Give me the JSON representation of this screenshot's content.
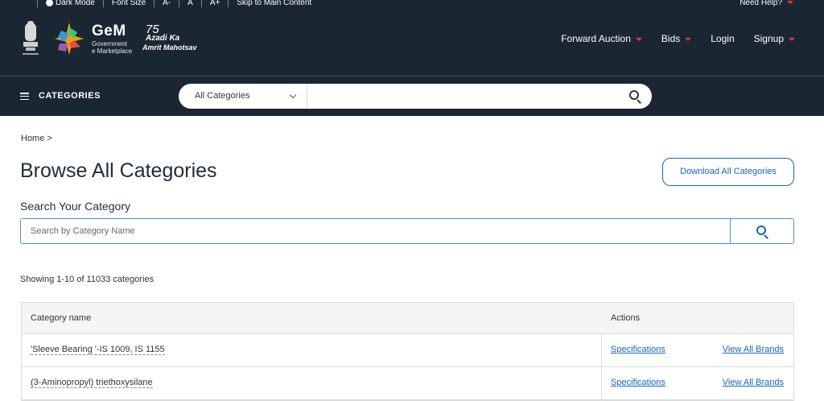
{
  "utility_bar": {
    "dark_mode_label": "Dark Mode",
    "font_size_label": "Font Size",
    "font_decrease": "A-",
    "font_normal": "A",
    "font_increase": "A+",
    "skip_link": "Skip to Main Content",
    "help_label": "Need Help?"
  },
  "header": {
    "logo_title": "GeM",
    "logo_line1": "Government",
    "logo_line2": "e Marketplace",
    "azadi_line1": "75",
    "azadi_line2": "Azadi Ka",
    "azadi_line3": "Amrit Mahotsav",
    "nav": {
      "forward_auction": "Forward Auction",
      "bids": "Bids",
      "login": "Login",
      "signup": "Signup"
    }
  },
  "category_bar": {
    "label": "CATEGORIES",
    "select_value": "All Categories",
    "search_value": ""
  },
  "main": {
    "breadcrumb": "Home >",
    "title": "Browse All Categories",
    "download_button": "Download All Categories",
    "search_heading": "Search Your Category",
    "search_placeholder": "Search by Category Name",
    "showing_text": "Showing 1-10 of 11033 categories"
  },
  "table": {
    "headers": {
      "name": "Category name",
      "actions": "Actions"
    },
    "rows": [
      {
        "name": "'Sleeve Bearing '-IS 1009, IS 1155",
        "spec_link": "Specifications",
        "brands_link": "View All Brands"
      },
      {
        "name": "(3-Aminopropyl) triethoxysilane",
        "spec_link": "Specifications",
        "brands_link": "View All Brands"
      }
    ]
  },
  "colors": {
    "header_bg": "#1a2733",
    "accent_red": "#e53935",
    "link_blue": "#1565c0"
  }
}
